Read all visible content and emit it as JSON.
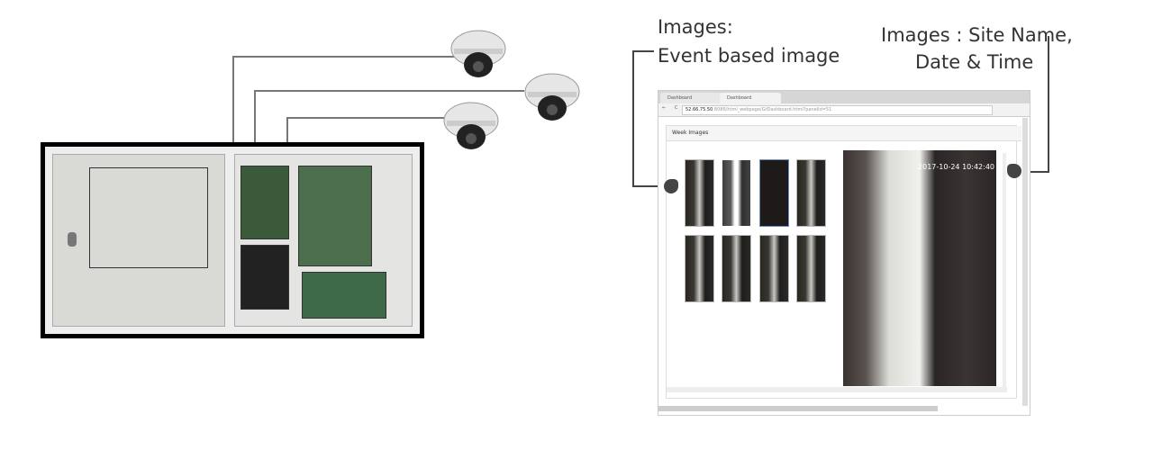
{
  "annotations": {
    "left_title": "Images:",
    "left_sub": "Event based image",
    "right_line1": "Images : Site Name,",
    "right_line2": "Date & Time"
  },
  "browser": {
    "tabs": [
      {
        "label": "Dashboard"
      },
      {
        "label": "Dashboard"
      }
    ],
    "url_host": "52.66.75.50",
    "url_path": ":8086/html_webpage/GtDashboard.html?panelid=51",
    "panel_title": "Week Images",
    "image_timestamp": "2017-10-24 10:42:40",
    "thumbnail_count": 8
  },
  "colors": {
    "annotation_text": "#333333",
    "connector": "#444444"
  }
}
